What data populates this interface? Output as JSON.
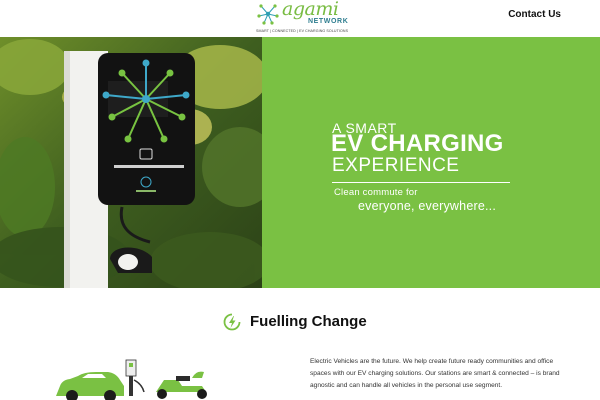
{
  "header": {
    "logo": {
      "name": "agami",
      "network": "NETWORK",
      "tagline": "SMART | CONNECTED | EV CHARGING SOLUTIONS"
    },
    "nav": {
      "contact_label": "Contact Us"
    }
  },
  "hero": {
    "line1": "A SMART",
    "line2": "EV CHARGING",
    "line3": "EXPERIENCE",
    "subline1": "Clean commute for",
    "subline2": "everyone, everywhere...",
    "photo_description": "EV charger",
    "accent_color": "#7ac143"
  },
  "section": {
    "icon": "lightning-bolt-icon",
    "title": "Fuelling Change",
    "body": "Electric Vehicles are the future. We help create future ready communities and office spaces with our EV charging solutions. Our stations are smart & connected – is brand agnostic and can handle all vehicles in the personal use segment."
  }
}
